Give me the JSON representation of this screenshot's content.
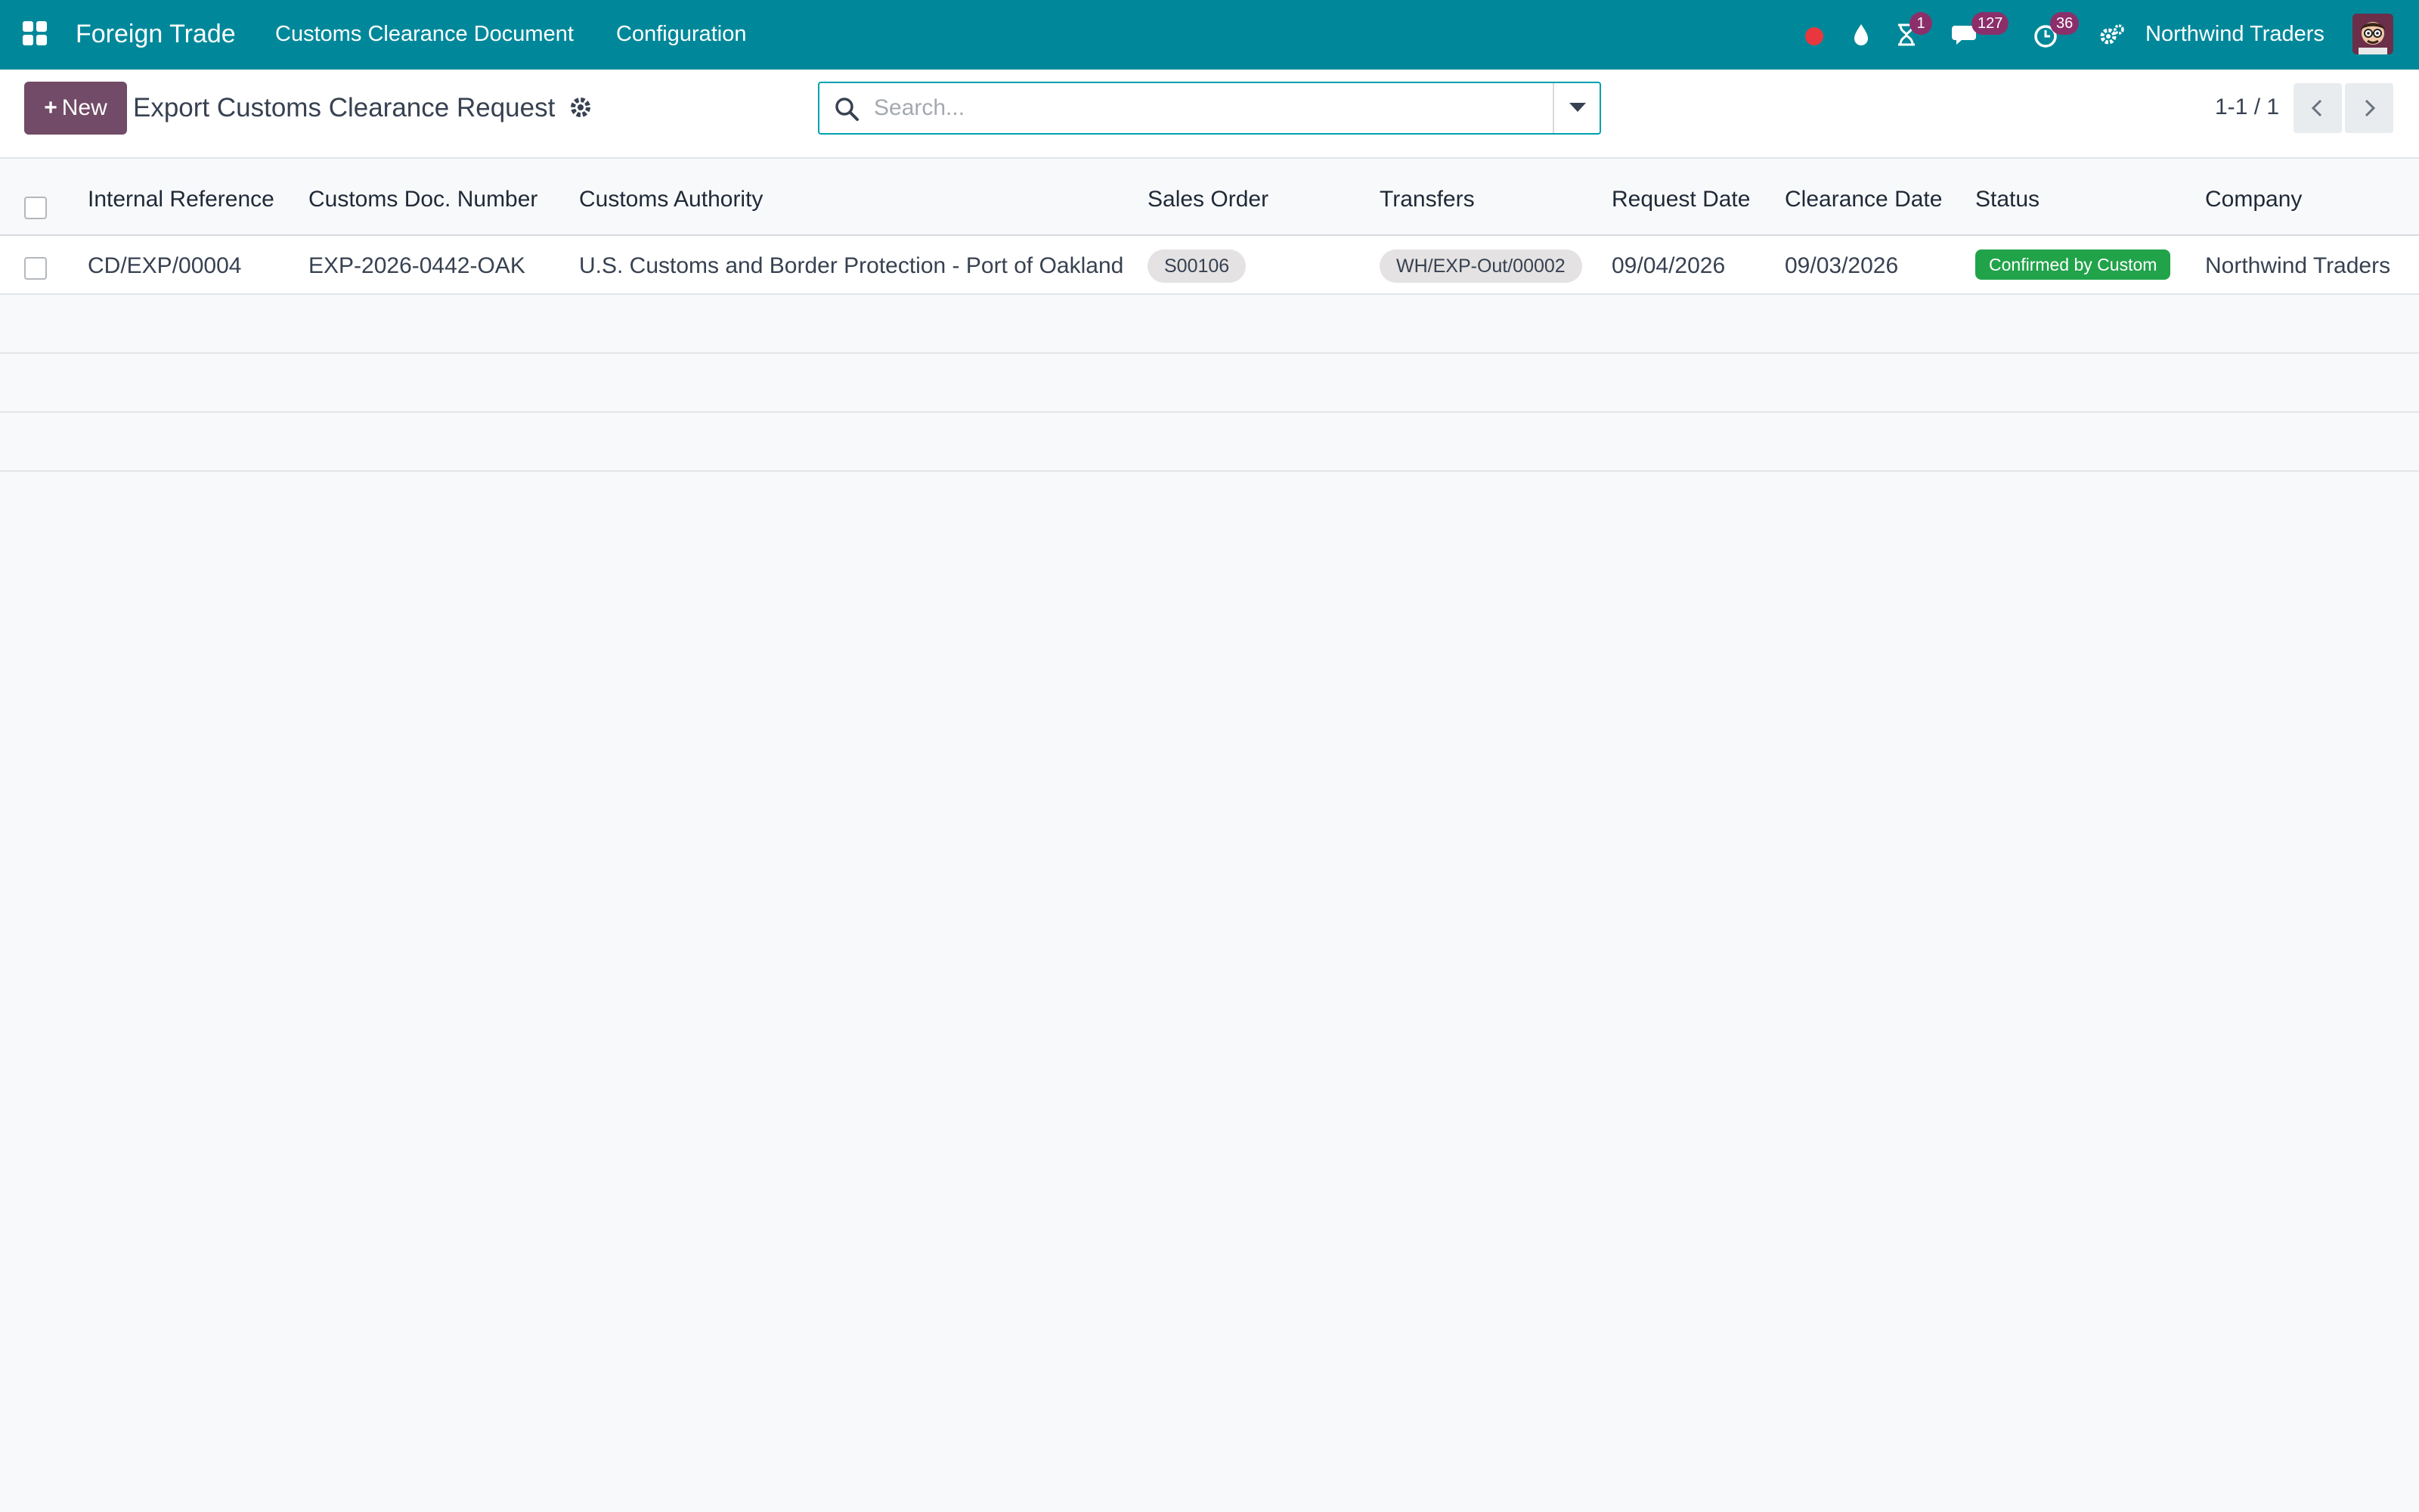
{
  "navbar": {
    "app_name": "Foreign Trade",
    "menu": [
      "Customs Clearance Document",
      "Configuration"
    ],
    "activity_badge": "1",
    "messages_badge": "127",
    "clock_badge": "36",
    "company": "Northwind Traders",
    "colors": {
      "bar": "#00889a",
      "badge": "#8b2f6b",
      "record_dot": "#e8373e"
    }
  },
  "control_panel": {
    "new_label": "New",
    "title": "Export Customs Clearance Request",
    "search_placeholder": "Search...",
    "pager": "1-1 / 1",
    "colors": {
      "new_button": "#714b67"
    }
  },
  "table": {
    "columns": [
      "Internal Reference",
      "Customs Doc. Number",
      "Customs Authority",
      "Sales Order",
      "Transfers",
      "Request Date",
      "Clearance Date",
      "Status",
      "Company"
    ],
    "rows": [
      {
        "internal_reference": "CD/EXP/00004",
        "customs_doc_number": "EXP-2026-0442-OAK",
        "customs_authority": "U.S. Customs and Border Protection - Port of Oakland",
        "sales_order": "S00106",
        "transfers": "WH/EXP-Out/00002",
        "request_date": "09/04/2026",
        "clearance_date": "09/03/2026",
        "status": "Confirmed by Custom",
        "status_color": "#21a34a",
        "company": "Northwind Traders"
      }
    ]
  }
}
